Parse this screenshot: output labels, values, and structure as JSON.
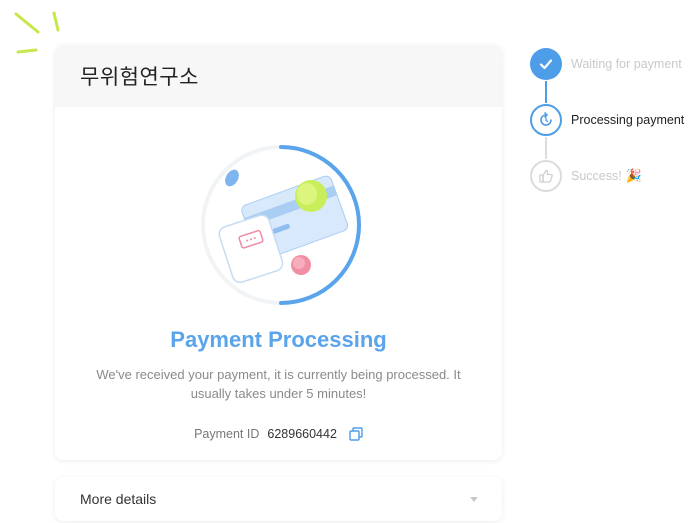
{
  "merchant": {
    "name": "무위험연구소"
  },
  "status": {
    "title": "Payment Processing",
    "description": "We've received your payment, it is currently being processed. It usually takes under 5 minutes!"
  },
  "payment": {
    "id_label": "Payment ID",
    "id_value": "6289660442"
  },
  "details": {
    "label": "More details"
  },
  "steps": [
    {
      "label": "Waiting for payment",
      "state": "done",
      "icon": "check-icon"
    },
    {
      "label": "Processing payment",
      "state": "active",
      "icon": "refresh-icon"
    },
    {
      "label": "Success!",
      "state": "pending",
      "icon": "thumbs-up-icon",
      "emoji": "🎉"
    }
  ],
  "colors": {
    "accent": "#4d9de8",
    "title": "#5aa4ec",
    "muted": "#c9c9c9"
  }
}
